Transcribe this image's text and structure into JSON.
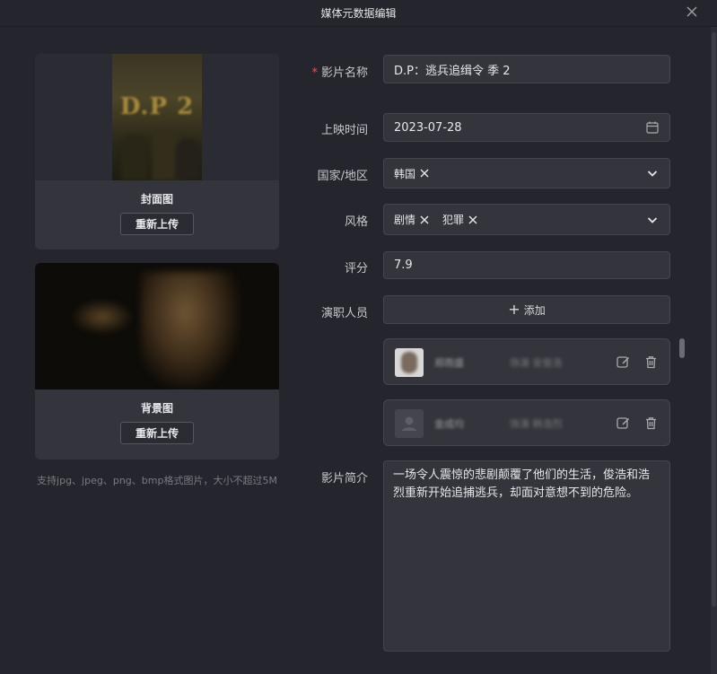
{
  "window": {
    "title": "媒体元数据编辑"
  },
  "cover": {
    "label": "封面图",
    "reupload": "重新上传",
    "poster_text": "D.P 2"
  },
  "background": {
    "label": "背景图",
    "reupload": "重新上传"
  },
  "hint": "支持jpg、jpeg、png、bmp格式图片，大小不超过5M",
  "form": {
    "name_label": "影片名称",
    "name_value": "D.P：逃兵追缉令 季 2",
    "release_label": "上映时间",
    "release_value": "2023-07-28",
    "country_label": "国家/地区",
    "country_tags": [
      "韩国"
    ],
    "genre_label": "风格",
    "genre_tags": [
      "剧情",
      "犯罪"
    ],
    "rating_label": "评分",
    "rating_value": "7.9",
    "cast_label": "演职人员",
    "add_label": "添加",
    "cast": [
      {
        "name": "郑雨盛",
        "role": "饰演 安俊浩"
      },
      {
        "name": "金成均",
        "role": "饰演 韩浩烈"
      }
    ],
    "synopsis_label": "影片简介",
    "synopsis_value": "一场令人震惊的悲剧颠覆了他们的生活，俊浩和浩烈重新开始追捕逃兵，却面对意想不到的危险。"
  },
  "icons": {
    "close": "close-icon",
    "calendar": "calendar-icon",
    "chevron": "chevron-down-icon",
    "tag_remove": "x-icon",
    "edit": "edit-icon",
    "delete": "trash-icon",
    "plus": "plus-icon"
  },
  "colors": {
    "required": "#e05a4e",
    "panel": "#34353c",
    "background": "#25262d"
  }
}
